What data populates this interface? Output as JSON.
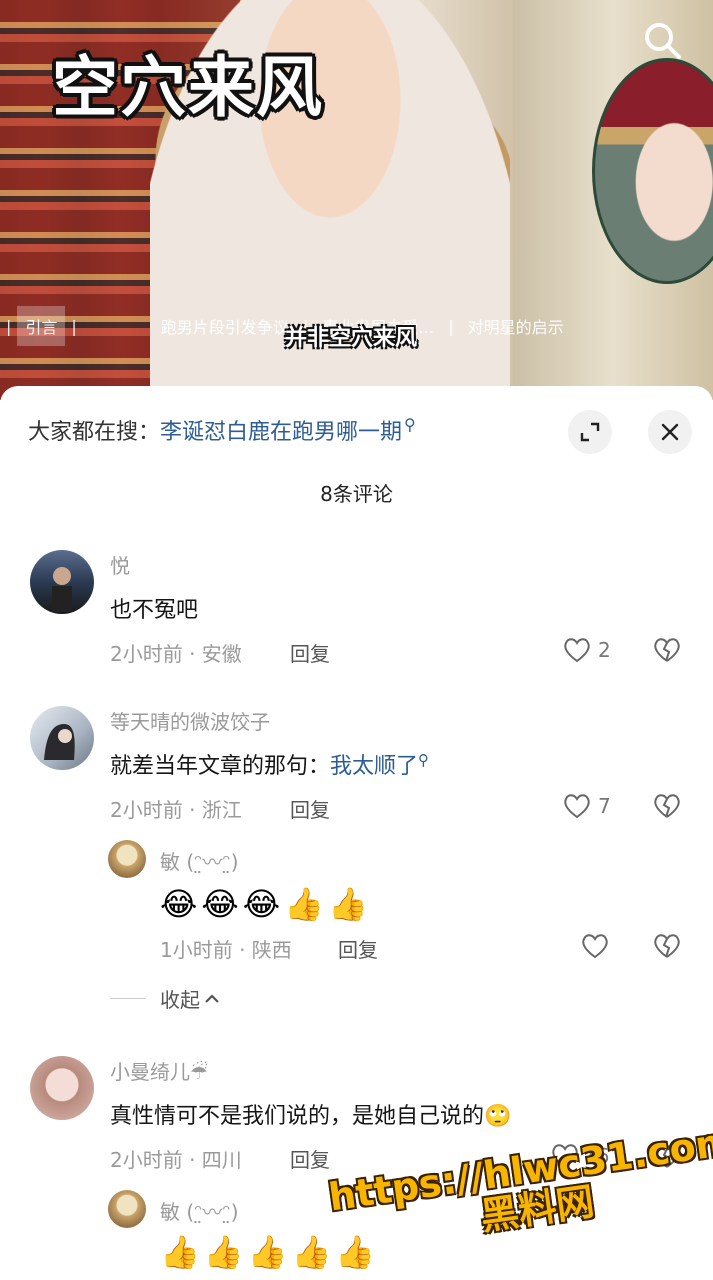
{
  "video": {
    "title": "空穴来风",
    "subtitle": "并非空穴来风",
    "chapters": [
      {
        "label": "引言",
        "active": true
      },
      {
        "label": "跑男片段引发争议",
        "active": false
      },
      {
        "label": "事业发展未受…",
        "active": false
      },
      {
        "label": "对明星的启示",
        "active": false
      }
    ]
  },
  "sheet": {
    "search_prefix": "大家都在搜：",
    "search_link": "李诞怼白鹿在跑男哪一期",
    "comment_count": "8条评论"
  },
  "comments": [
    {
      "name": "悦",
      "text": "也不冤吧",
      "meta": "2小时前 · 安徽",
      "reply": "回复",
      "likes": "2"
    },
    {
      "name": "等天晴的微波饺子",
      "text": "就差当年文章的那句：",
      "link": "我太顺了",
      "meta": "2小时前 · 浙江",
      "reply": "回复",
      "likes": "7",
      "replies": [
        {
          "name": "敏 (ᵔ̤〰ᵔ̤)",
          "emojis": [
            "😂",
            "😂",
            "😂",
            "👍",
            "👍"
          ],
          "meta": "1小时前 · 陕西",
          "reply": "回复"
        }
      ],
      "collapse": "收起"
    },
    {
      "name": "小曼绮儿☔",
      "text": "真性情可不是我们说的，是她自己说的🙄",
      "meta": "2小时前 · 四川",
      "reply": "回复",
      "likes": "16",
      "replies": [
        {
          "name": "敏 (ᵔ̤〰ᵔ̤)",
          "emojis": [
            "👍",
            "👍",
            "👍",
            "👍",
            "👍"
          ]
        }
      ]
    }
  ],
  "watermark": {
    "line1": "https://hlwc31.com",
    "line2": "黑料网"
  },
  "colors": {
    "link": "#2d5d95",
    "meta": "#9a9a9a"
  }
}
